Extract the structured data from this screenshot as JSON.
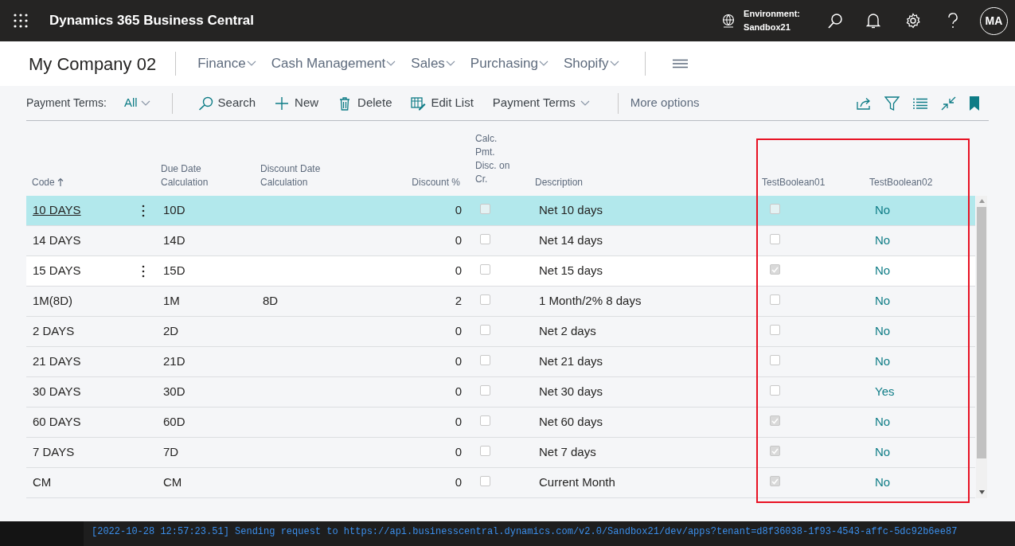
{
  "app_bar": {
    "title": "Dynamics 365 Business Central",
    "environment_label": "Environment:",
    "environment_name": "Sandbox21",
    "avatar": "MA"
  },
  "header": {
    "company": "My Company 02",
    "nav": [
      "Finance",
      "Cash Management",
      "Sales",
      "Purchasing",
      "Shopify"
    ]
  },
  "toolbar": {
    "view_label": "Payment Terms:",
    "view_filter": "All",
    "actions": [
      {
        "kind": "search",
        "label": "Search"
      },
      {
        "kind": "new",
        "label": "New"
      },
      {
        "kind": "delete",
        "label": "Delete"
      },
      {
        "kind": "edit",
        "label": "Edit List"
      },
      {
        "kind": "dropdown",
        "label": "Payment Terms"
      }
    ],
    "more": "More options"
  },
  "table": {
    "columns": [
      "Code",
      "Due Date Calculation",
      "Discount Date Calculation",
      "Discount %",
      "Calc. Pmt. Disc. on Cr.",
      "Description",
      "TestBoolean01",
      "TestBoolean02"
    ],
    "rows": [
      {
        "code": "10 DAYS",
        "due": "10D",
        "disc_date": "",
        "disc_pct": "0",
        "calc": false,
        "description": "Net 10 days",
        "tb01": false,
        "tb02": "No",
        "selected": true,
        "hovered": false
      },
      {
        "code": "14 DAYS",
        "due": "14D",
        "disc_date": "",
        "disc_pct": "0",
        "calc": false,
        "description": "Net 14 days",
        "tb01": false,
        "tb02": "No",
        "selected": false,
        "hovered": false
      },
      {
        "code": "15 DAYS",
        "due": "15D",
        "disc_date": "",
        "disc_pct": "0",
        "calc": false,
        "description": "Net 15 days",
        "tb01": true,
        "tb02": "No",
        "selected": false,
        "hovered": true
      },
      {
        "code": "1M(8D)",
        "due": "1M",
        "disc_date": "8D",
        "disc_pct": "2",
        "calc": false,
        "description": "1 Month/2% 8 days",
        "tb01": false,
        "tb02": "No",
        "selected": false,
        "hovered": false
      },
      {
        "code": "2 DAYS",
        "due": "2D",
        "disc_date": "",
        "disc_pct": "0",
        "calc": false,
        "description": "Net 2 days",
        "tb01": false,
        "tb02": "No",
        "selected": false,
        "hovered": false
      },
      {
        "code": "21 DAYS",
        "due": "21D",
        "disc_date": "",
        "disc_pct": "0",
        "calc": false,
        "description": "Net 21 days",
        "tb01": false,
        "tb02": "No",
        "selected": false,
        "hovered": false
      },
      {
        "code": "30 DAYS",
        "due": "30D",
        "disc_date": "",
        "disc_pct": "0",
        "calc": false,
        "description": "Net 30 days",
        "tb01": false,
        "tb02": "Yes",
        "selected": false,
        "hovered": false
      },
      {
        "code": "60 DAYS",
        "due": "60D",
        "disc_date": "",
        "disc_pct": "0",
        "calc": false,
        "description": "Net 60 days",
        "tb01": true,
        "tb02": "No",
        "selected": false,
        "hovered": false
      },
      {
        "code": "7 DAYS",
        "due": "7D",
        "disc_date": "",
        "disc_pct": "0",
        "calc": false,
        "description": "Net 7 days",
        "tb01": true,
        "tb02": "No",
        "selected": false,
        "hovered": false
      },
      {
        "code": "CM",
        "due": "CM",
        "disc_date": "",
        "disc_pct": "0",
        "calc": false,
        "description": "Current Month",
        "tb01": true,
        "tb02": "No",
        "selected": false,
        "hovered": false
      }
    ]
  },
  "terminal": {
    "line": "[2022-10-28 12:57:23.51] Sending request to https://api.businesscentral.dynamics.com/v2.0/Sandbox21/dev/apps?tenant=d8f36038-1f93-4543-affc-5dc92b6ee87"
  }
}
